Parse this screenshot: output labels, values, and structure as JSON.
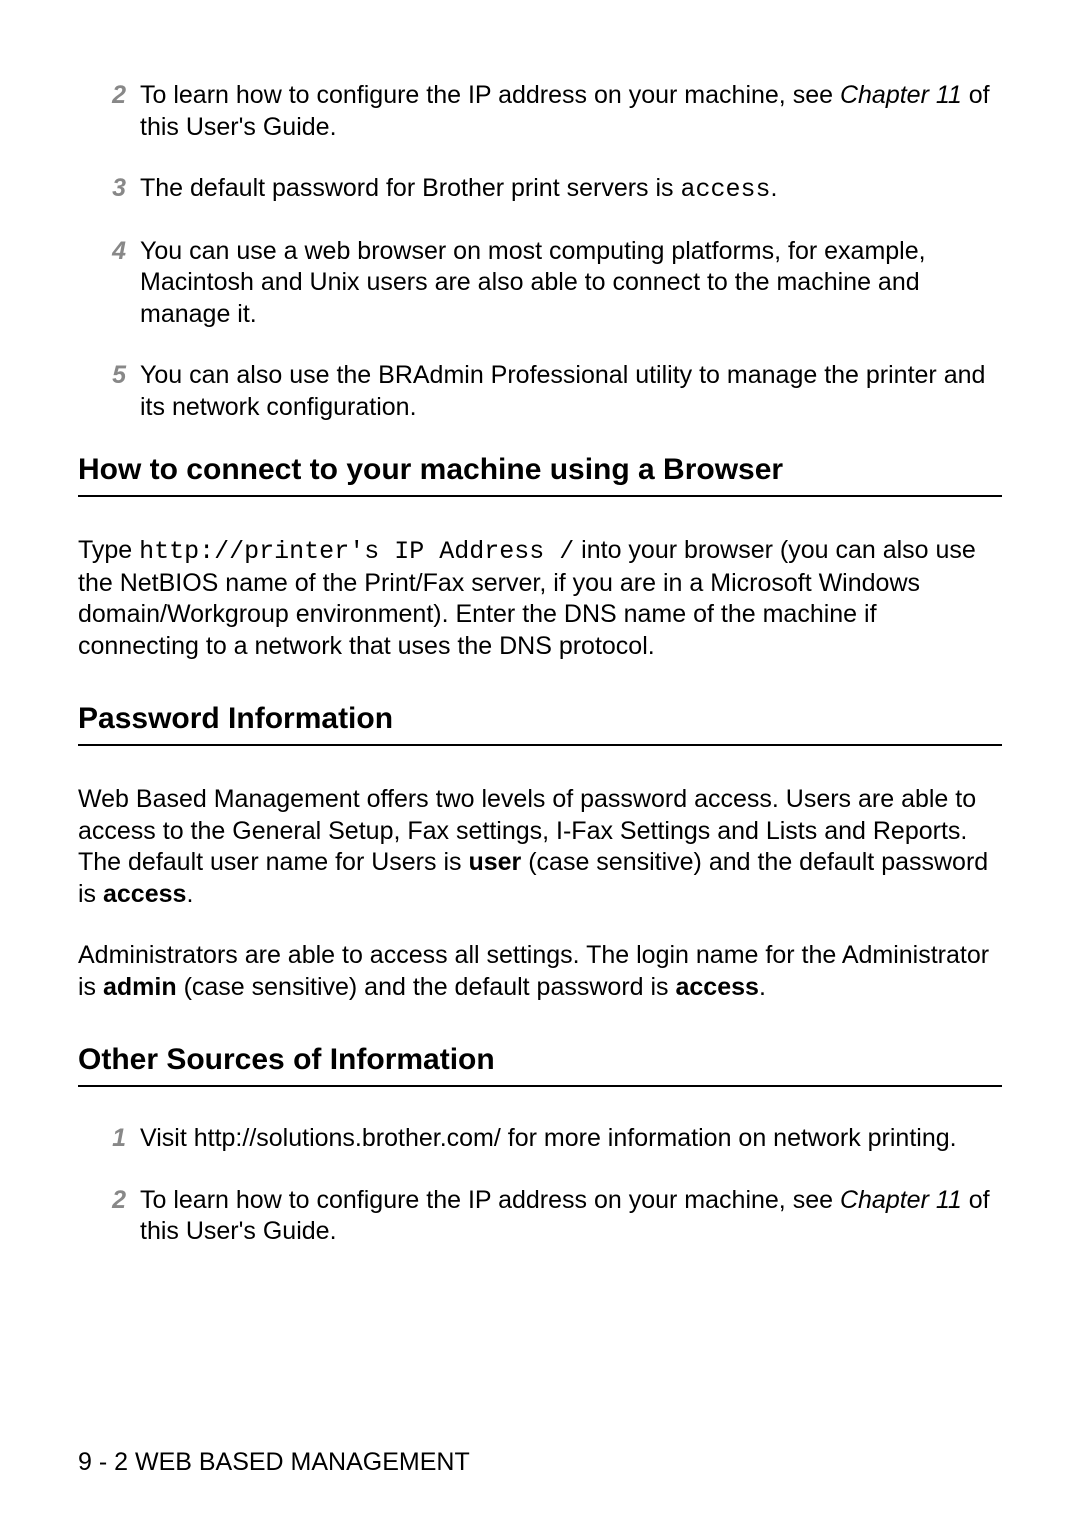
{
  "top_items": [
    {
      "num": "2",
      "pre": "To learn how to configure the IP address on your machine, see ",
      "chapter": "Chapter 11",
      "post": " of this User's Guide."
    },
    {
      "num": "3",
      "pre": "The default password for Brother print servers is ",
      "mono": "access",
      "post": "."
    },
    {
      "num": "4",
      "text": "You can use a web browser on most computing platforms, for example, Macintosh and Unix users are also able to connect to the machine and manage it."
    },
    {
      "num": "5",
      "text": "You can also use the BRAdmin Professional utility to manage the printer and its network configuration."
    }
  ],
  "heading_connect": "How to connect to your machine using a Browser",
  "connect_para": {
    "pre": "Type ",
    "mono": "http://printer's IP Address /",
    "post": " into your browser (you can also use the NetBIOS name of the Print/Fax server, if you are in a Microsoft Windows domain/Workgroup environment). Enter the DNS name of the machine if connecting to a network that uses the DNS protocol."
  },
  "heading_password": "Password Information",
  "password_para1": {
    "pre": "Web Based Management offers two levels of password access. Users are able to access to the General Setup, Fax settings, I-Fax Settings and Lists and Reports. The default user name for Users is ",
    "bold1": "user",
    "mid": " (case sensitive) and the default password is ",
    "bold2": "access",
    "post": "."
  },
  "password_para2": {
    "pre": "Administrators are able to access all settings. The login name for the Administrator is ",
    "bold1": "admin",
    "mid": " (case sensitive) and the default password is ",
    "bold2": "access",
    "post": "."
  },
  "heading_other": "Other Sources of Information",
  "other_items": [
    {
      "num": "1",
      "text": "Visit http://solutions.brother.com/ for more information on network printing."
    },
    {
      "num": "2",
      "pre": "To learn how to configure the IP address on your machine, see ",
      "chapter": "Chapter 11",
      "post": " of this User's Guide."
    }
  ],
  "footer": "9 - 2 WEB BASED MANAGEMENT"
}
